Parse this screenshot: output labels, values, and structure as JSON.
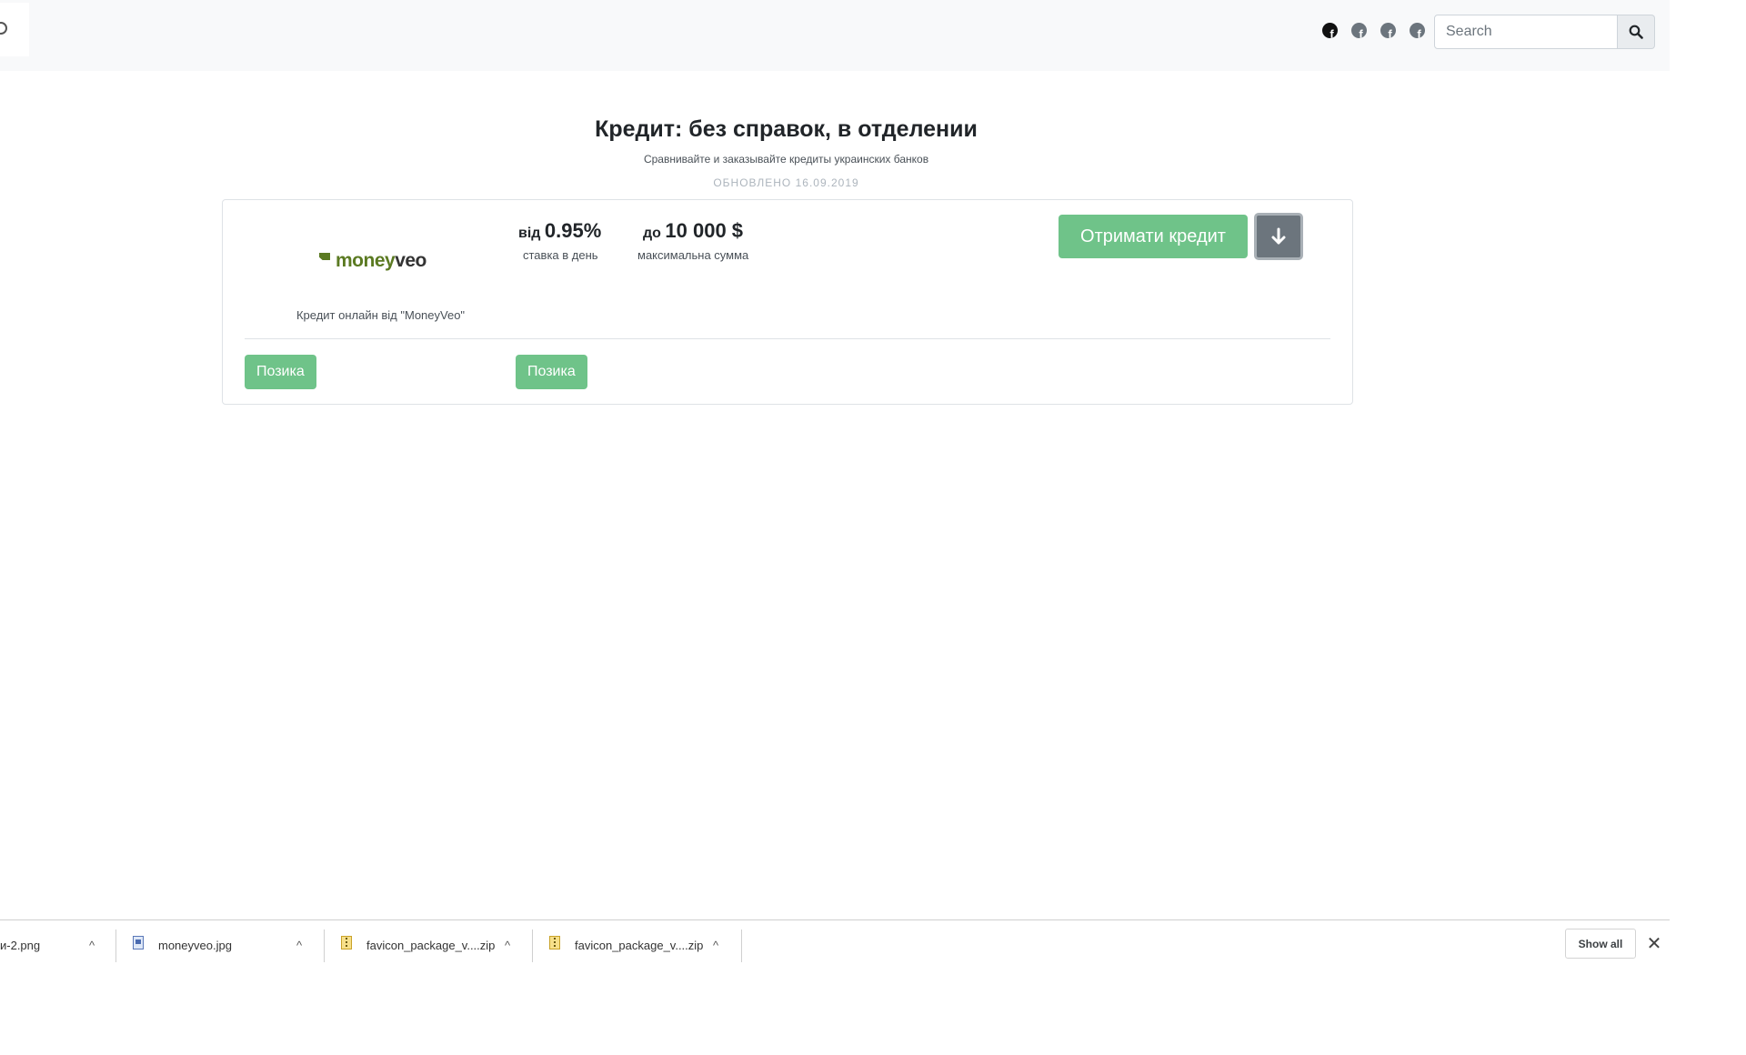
{
  "header": {
    "search": {
      "placeholder": "Search"
    }
  },
  "page": {
    "title": "Кредит: без справок, в отделении",
    "subtitle": "Сравнивайте и заказывайте кредиты украинских банков",
    "updated": "ОБНОВЛЕНО 16.09.2019"
  },
  "offer": {
    "logo": {
      "part1": "money",
      "part2": "veo"
    },
    "rate": {
      "prefix": "від",
      "value": "0.95%",
      "label": "ставка в день"
    },
    "amount": {
      "prefix": "до",
      "value": "10 000 $",
      "label": "максимальна сумма"
    },
    "cta_label": "Отримати кредит",
    "description": "Кредит онлайн від \"MoneyVeo\"",
    "tags": [
      "Позика",
      "Позика"
    ]
  },
  "downloads": {
    "items": [
      {
        "name": "и-2.png"
      },
      {
        "name": "moneyveo.jpg"
      },
      {
        "name": "favicon_package_v....zip"
      },
      {
        "name": "favicon_package_v....zip"
      }
    ],
    "show_all_label": "Show all",
    "close_glyph": "✕",
    "caret_glyph": "^"
  },
  "colors": {
    "accent_green": "#6fc389",
    "secondary_gray": "#6c757d",
    "navbar_bg": "#f8f9fa",
    "brand_green": "#5b7a22"
  },
  "icons": {
    "social": [
      "facebook-icon",
      "facebook-icon",
      "facebook-icon",
      "facebook-icon"
    ],
    "search_button": "search-icon",
    "more_button": "arrow-down-icon"
  }
}
